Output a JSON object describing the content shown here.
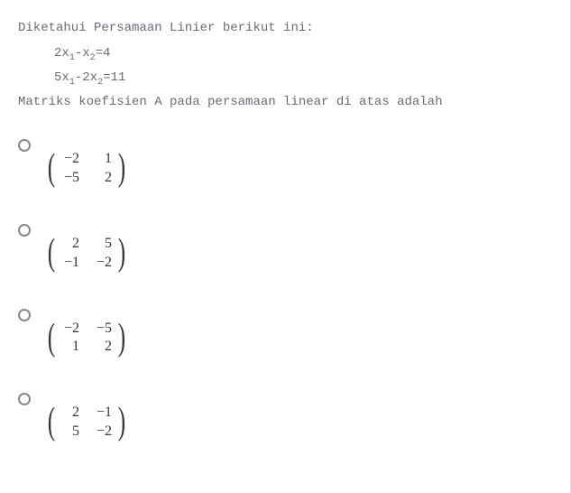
{
  "question": {
    "intro": "Diketahui Persamaan Linier berikut ini:",
    "eq1_part1": "2x",
    "eq1_sub1": "1",
    "eq1_part2": "-x",
    "eq1_sub2": "2",
    "eq1_part3": "=4",
    "eq2_part1": "5x",
    "eq2_sub1": "1",
    "eq2_part2": "-2x",
    "eq2_sub2": "2",
    "eq2_part3": "=11",
    "ask": "Matriks koefisien A pada persamaan linear di atas adalah"
  },
  "options": [
    {
      "r1c1": "−2",
      "r1c2": "1",
      "r2c1": "−5",
      "r2c2": "2"
    },
    {
      "r1c1": "2",
      "r1c2": "5",
      "r2c1": "−1",
      "r2c2": "−2"
    },
    {
      "r1c1": "−2",
      "r1c2": "−5",
      "r2c1": "1",
      "r2c2": "2"
    },
    {
      "r1c1": "2",
      "r1c2": "−1",
      "r2c1": "5",
      "r2c2": "−2"
    }
  ]
}
